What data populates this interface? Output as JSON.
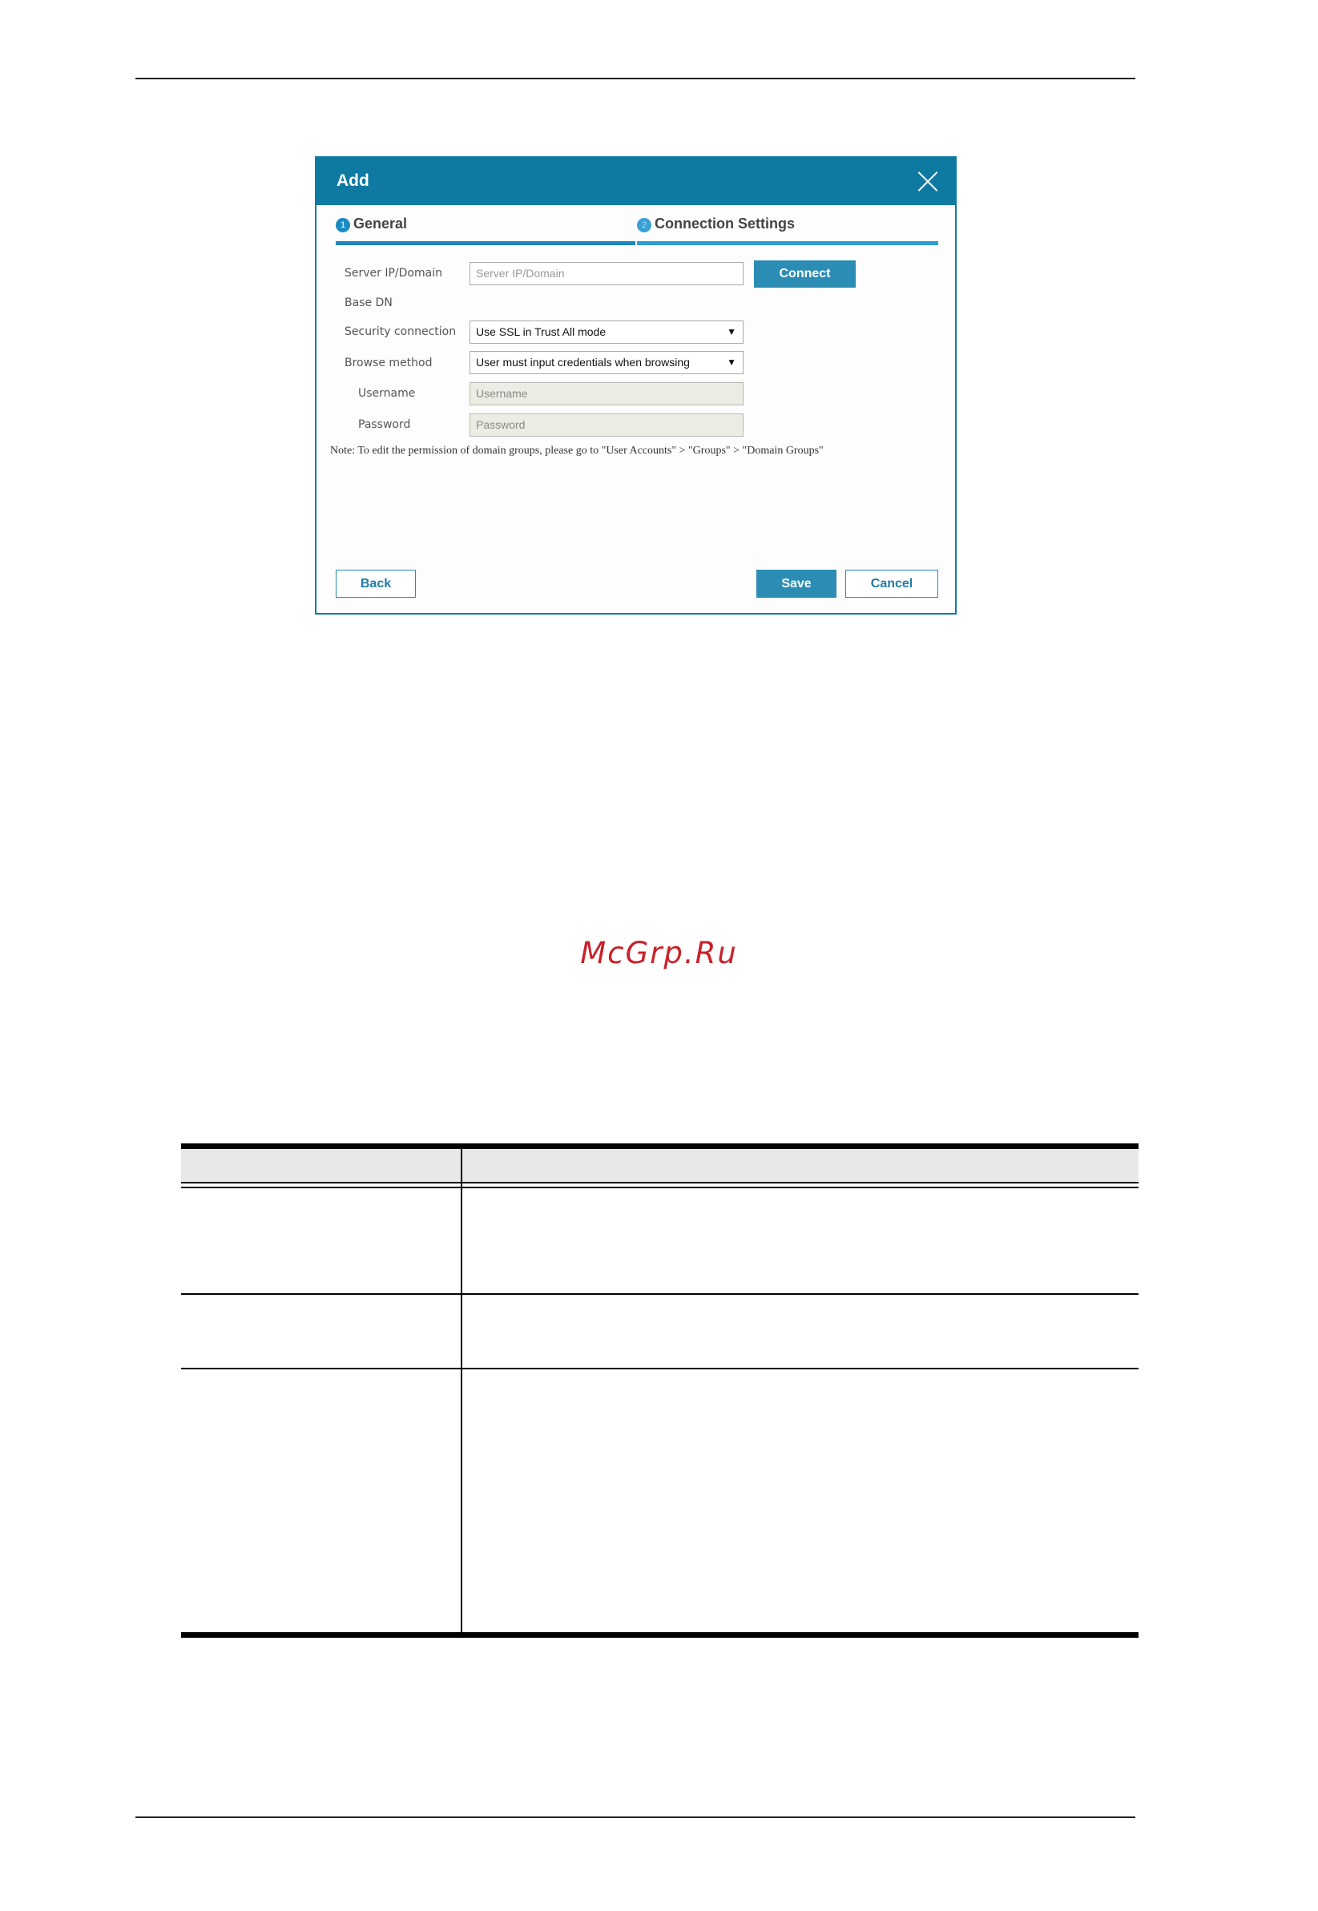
{
  "dialog": {
    "title": "Add",
    "steps": [
      {
        "number": "1",
        "label": "General"
      },
      {
        "number": "2",
        "label": "Connection Settings"
      }
    ],
    "fields": {
      "server": {
        "label": "Server IP/Domain",
        "placeholder": "Server IP/Domain"
      },
      "base_dn": {
        "label": "Base DN"
      },
      "security": {
        "label": "Security connection",
        "value": "Use SSL in Trust All mode"
      },
      "browse": {
        "label": "Browse method",
        "value": "User must input credentials when browsing"
      },
      "username": {
        "label": "Username",
        "placeholder": "Username"
      },
      "password": {
        "label": "Password",
        "placeholder": "Password"
      }
    },
    "connect_label": "Connect",
    "note": "Note: To edit the permission of domain groups, please go to \"User Accounts\" > \"Groups\" > \"Domain Groups\"",
    "buttons": {
      "back": "Back",
      "save": "Save",
      "cancel": "Cancel"
    },
    "colors": {
      "header": "#0e7aa1",
      "accent": "#2b8cb4"
    }
  },
  "watermark": "McGrp.Ru",
  "table": {
    "headers": [
      "",
      ""
    ],
    "rows": [
      [
        "",
        ""
      ],
      [
        "",
        ""
      ],
      [
        "",
        ""
      ]
    ]
  }
}
